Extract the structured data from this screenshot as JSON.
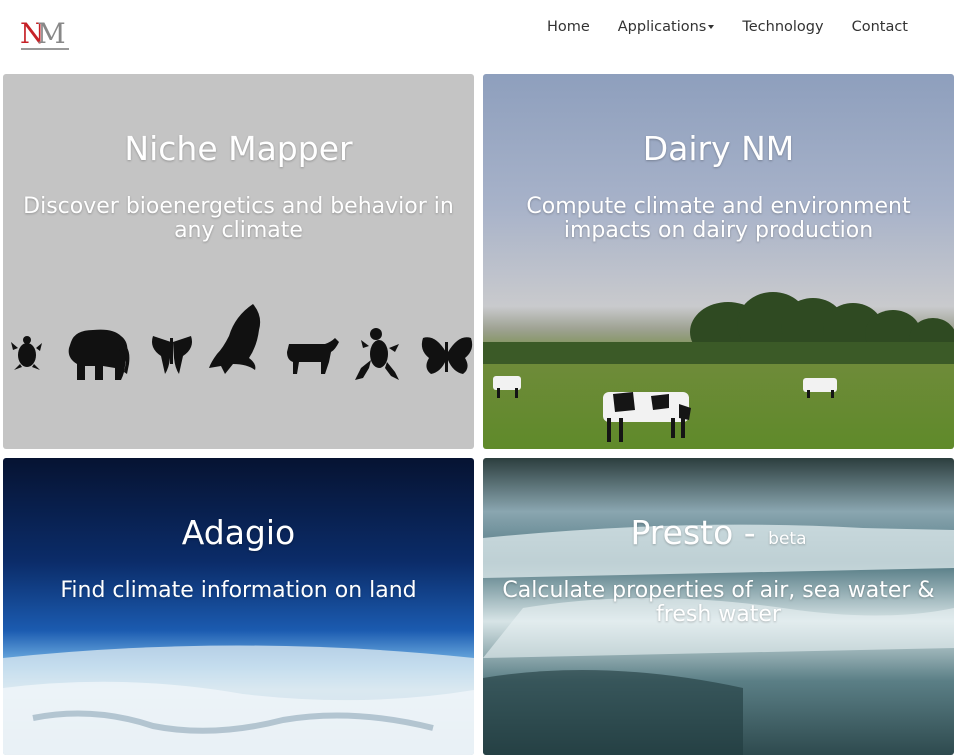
{
  "logo": {
    "letter_n": "N",
    "letter_m": "M"
  },
  "nav": {
    "items": [
      {
        "label": "Home"
      },
      {
        "label": "Applications"
      },
      {
        "label": "Technology"
      },
      {
        "label": "Contact"
      }
    ]
  },
  "tiles": [
    {
      "title": "Niche Mapper",
      "subtitle": "Discover bioenergetics and behavior in any climate"
    },
    {
      "title": "Dairy NM",
      "subtitle": "Compute climate and environment impacts on dairy production"
    },
    {
      "title": "Adagio",
      "subtitle": "Find climate information on land"
    },
    {
      "title": "Presto -",
      "badge": "beta",
      "subtitle": "Calculate properties of air, sea water & fresh water"
    }
  ],
  "colors": {
    "logo_n": "#c62127",
    "logo_m": "#888888",
    "tile_niche_bg": "#c4c4c4",
    "nav_text": "#333333"
  }
}
